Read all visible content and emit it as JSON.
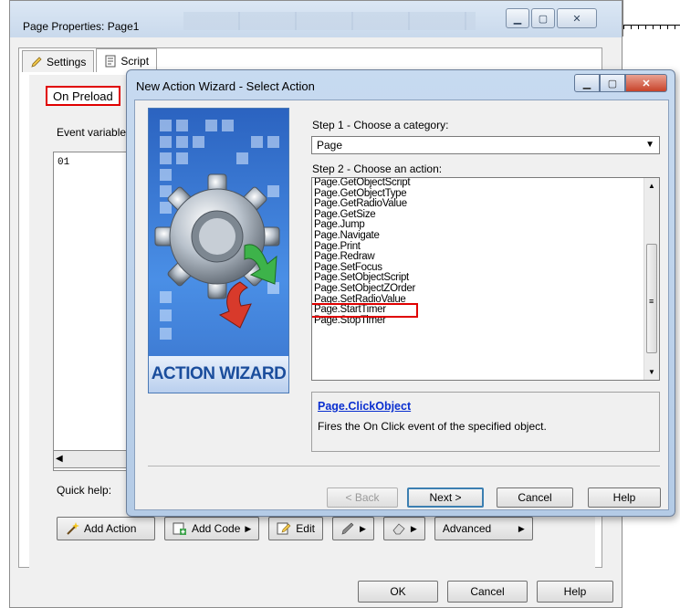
{
  "outer_window": {
    "title": "Page Properties: Page1",
    "tabs": [
      {
        "label": "Settings"
      },
      {
        "label": "Script"
      }
    ],
    "event_tab": "On Preload",
    "event_variables_label": "Event variable",
    "script_line": "01",
    "quick_help_label": "Quick help:",
    "toolbar": {
      "add_action": "Add Action",
      "add_code": "Add Code",
      "edit": "Edit",
      "advanced": "Advanced"
    },
    "footer": {
      "ok": "OK",
      "cancel": "Cancel",
      "help": "Help"
    }
  },
  "wizard": {
    "title": "New Action Wizard - Select Action",
    "banner_label": "ACTION WIZARD",
    "step1_label": "Step 1 - Choose a category:",
    "category_selected": "Page",
    "step2_label": "Step 2 - Choose an action:",
    "actions": [
      "Page.GetObjectScript",
      "Page.GetObjectType",
      "Page.GetRadioValue",
      "Page.GetSize",
      "Page.Jump",
      "Page.Navigate",
      "Page.Print",
      "Page.Redraw",
      "Page.SetFocus",
      "Page.SetObjectScript",
      "Page.SetObjectZOrder",
      "Page.SetRadioValue",
      "Page.StartTimer",
      "Page.StopTimer"
    ],
    "highlighted_action": "Page.StartTimer",
    "help_link": "Page.ClickObject",
    "help_description": "Fires the On Click event of the specified object.",
    "buttons": {
      "back": "< Back",
      "next": "Next >",
      "cancel": "Cancel",
      "help": "Help"
    }
  },
  "colors": {
    "highlight_red": "#e00000",
    "link_blue": "#0a2fd0",
    "wizard_banner": "#2b63c0"
  }
}
